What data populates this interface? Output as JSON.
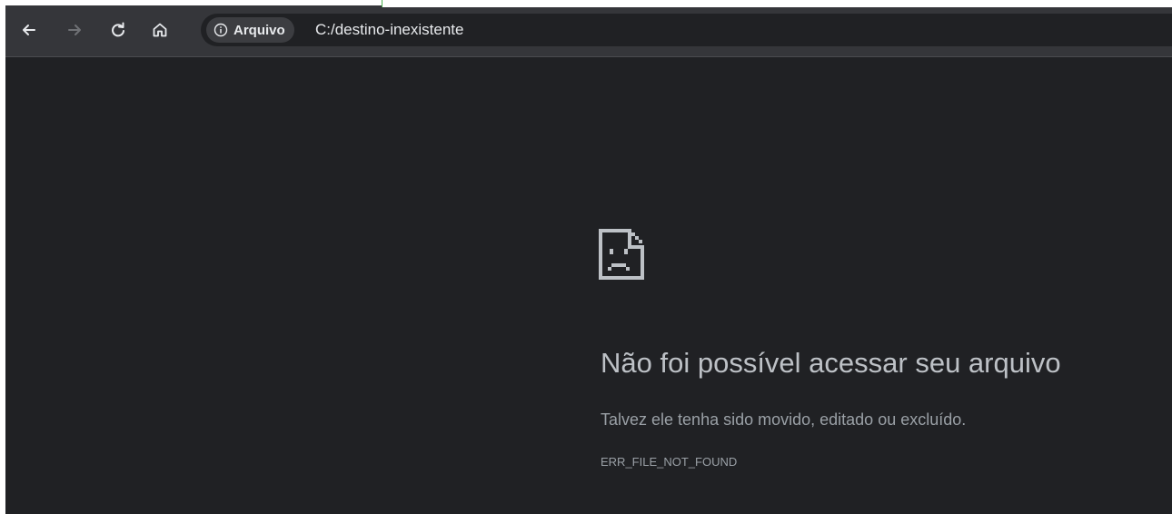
{
  "toolbar": {
    "back_icon": "arrow-left-icon",
    "forward_icon": "arrow-right-icon",
    "reload_icon": "reload-icon",
    "home_icon": "home-icon"
  },
  "omnibox": {
    "chip_icon": "info-icon",
    "chip_label": "Arquivo",
    "url": "C:/destino-inexistente"
  },
  "error_page": {
    "icon": "sad-file-icon",
    "title": "Não foi possível acessar seu arquivo",
    "description": "Talvez ele tenha sido movido, editado ou excluído.",
    "error_code": "ERR_FILE_NOT_FOUND"
  },
  "colors": {
    "toolbar_bg": "#35363a",
    "page_bg": "#202124",
    "icon_color": "#bdc1c6",
    "text_primary": "#e8eaed",
    "text_secondary": "#9aa0a6"
  }
}
